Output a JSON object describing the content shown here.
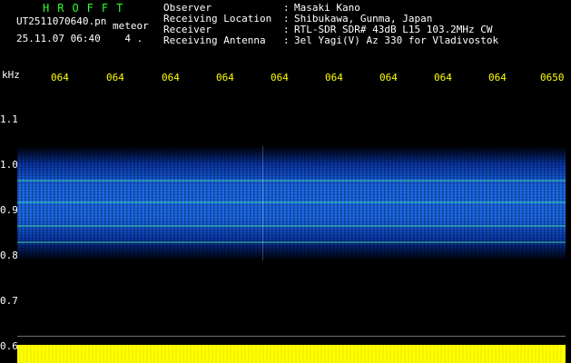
{
  "header": {
    "title": "HROFFT",
    "file_name": "UT2511070640.pn",
    "event_type": "meteor",
    "datetime": "25.11.07 06:40",
    "marker": "4 ."
  },
  "meta": [
    {
      "key": "Observer",
      "value": "Masaki Kano"
    },
    {
      "key": "Receiving Location",
      "value": "Shibukawa, Gunma, Japan"
    },
    {
      "key": "Receiver",
      "value": "RTL-SDR SDR# 43dB L15 103.2MHz CW"
    },
    {
      "key": "Receiving Antenna",
      "value": "3el Yagi(V) Az 330 for Vladivostok"
    }
  ],
  "axis": {
    "unit": "kHz",
    "time_ticks": [
      "064",
      "064",
      "064",
      "064",
      "064",
      "064",
      "064",
      "064",
      "064",
      "0650"
    ],
    "freq_ticks": [
      "1.1",
      "1.0",
      "0.9",
      "0.8",
      "0.7",
      "0.6"
    ]
  },
  "colors": {
    "title": "#2CFF2C",
    "tick": "#FFFF00",
    "text": "#FFFFFF",
    "signal": "#1E74FF",
    "noise": "#FFFF00"
  }
}
